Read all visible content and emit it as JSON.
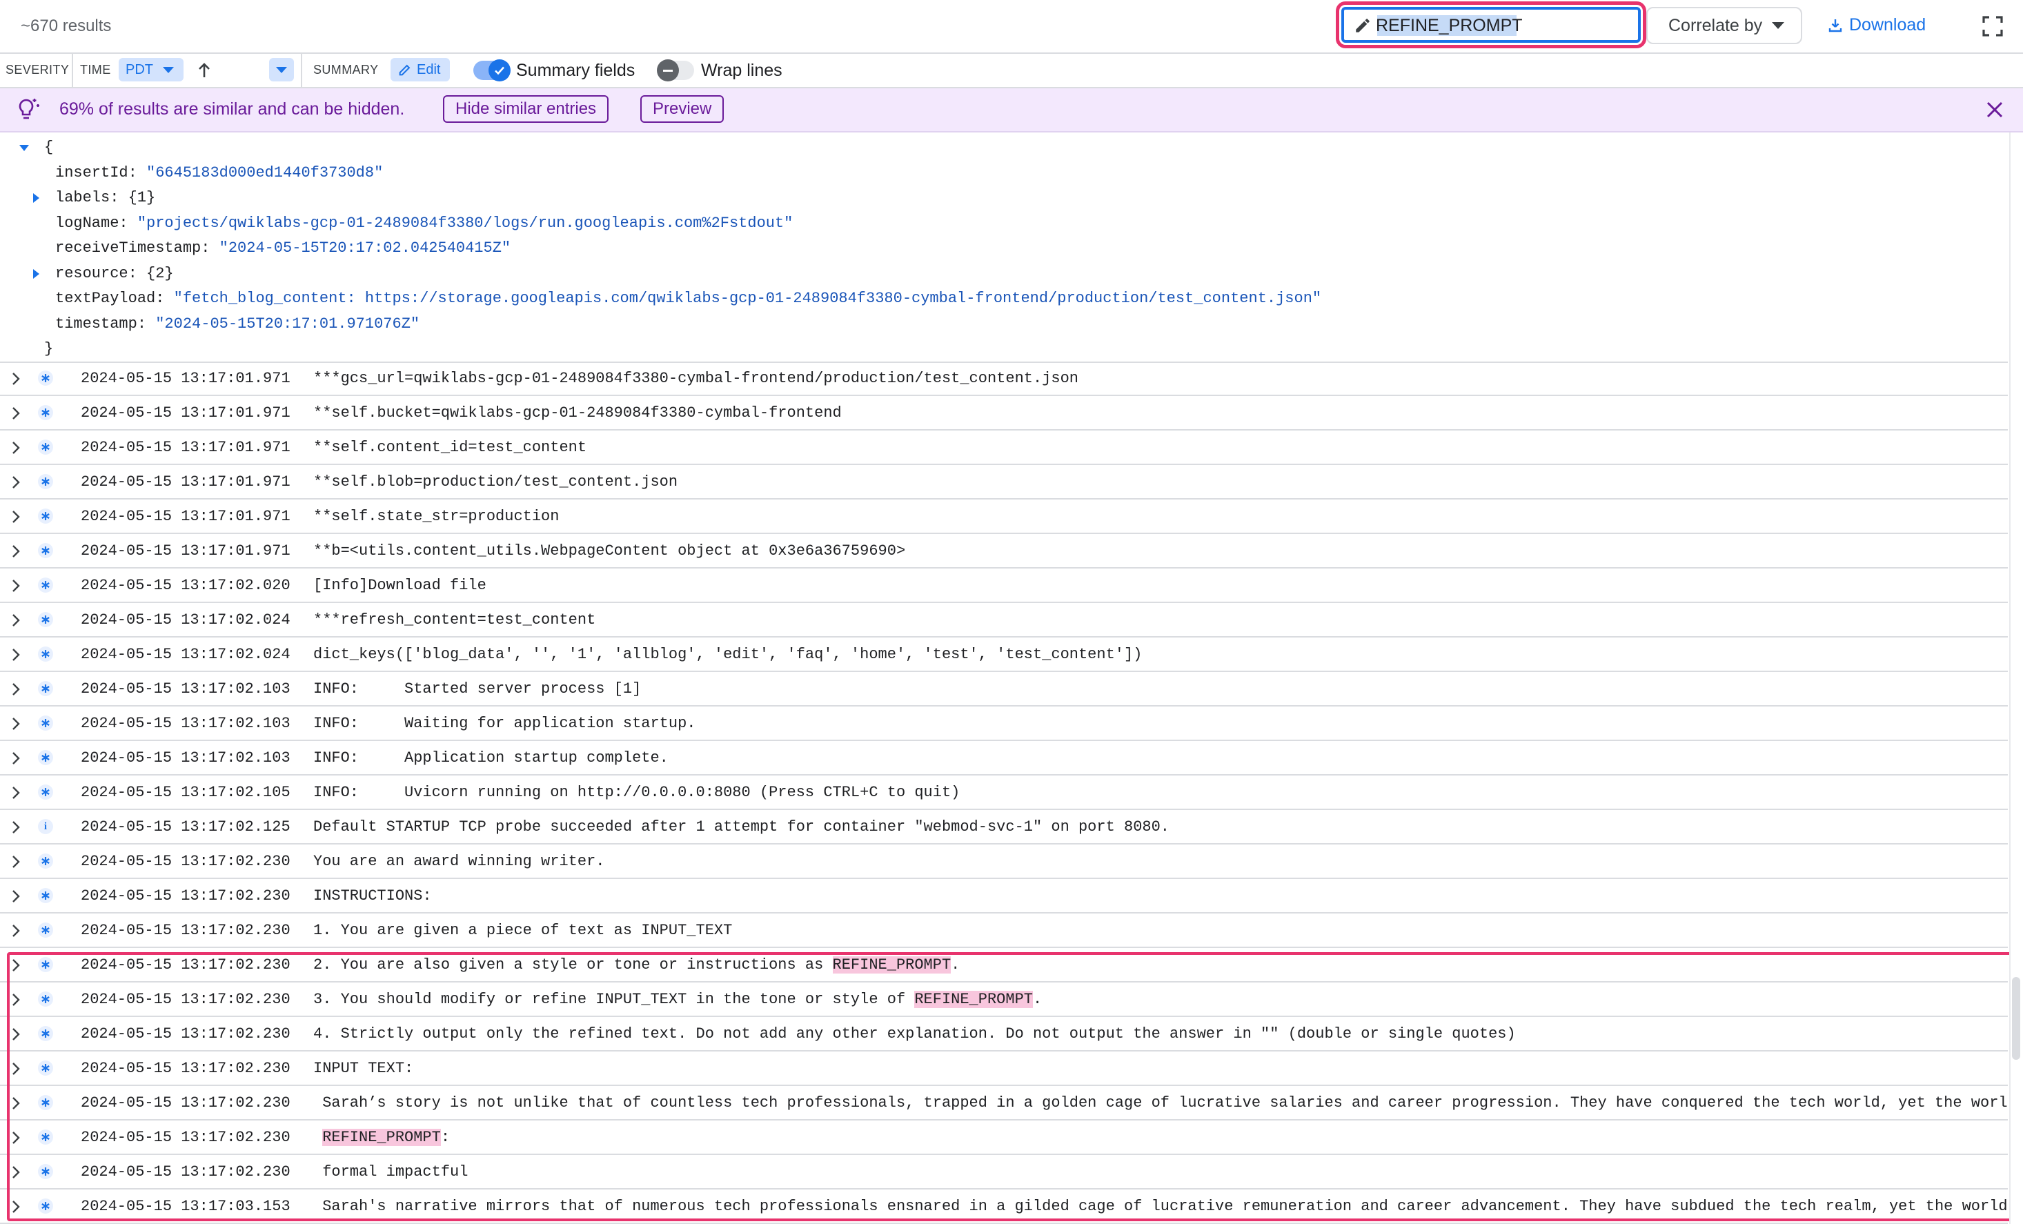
{
  "toolbar": {
    "results_count": "~670 results",
    "search_value": "REFINE_PROMPT",
    "correlate_label": "Correlate by",
    "download_label": "Download"
  },
  "columns": {
    "severity": "SEVERITY",
    "time": "TIME",
    "timezone": "PDT",
    "summary": "SUMMARY",
    "edit_label": "Edit",
    "summary_fields_label": "Summary fields",
    "summary_fields_on": true,
    "wrap_lines_label": "Wrap lines",
    "wrap_lines_on": false
  },
  "banner": {
    "message": "69% of results are similar and can be hidden.",
    "hide_label": "Hide similar entries",
    "preview_label": "Preview"
  },
  "expanded_entry": {
    "open_brace": "{",
    "close_brace": "}",
    "fields": [
      {
        "key": "insertId",
        "value": "\"6645183d000ed1440f3730d8\"",
        "expandable": false
      },
      {
        "key": "labels",
        "value": "{1}",
        "expandable": true
      },
      {
        "key": "logName",
        "value": "\"projects/qwiklabs-gcp-01-2489084f3380/logs/run.googleapis.com%2Fstdout\"",
        "expandable": false
      },
      {
        "key": "receiveTimestamp",
        "value": "\"2024-05-15T20:17:02.042540415Z\"",
        "expandable": false
      },
      {
        "key": "resource",
        "value": "{2}",
        "expandable": true
      },
      {
        "key": "textPayload",
        "value": "\"fetch_blog_content: https://storage.googleapis.com/qwiklabs-gcp-01-2489084f3380-cymbal-frontend/production/test_content.json\"",
        "expandable": false
      },
      {
        "key": "timestamp",
        "value": "\"2024-05-15T20:17:01.971076Z\"",
        "expandable": false
      }
    ]
  },
  "log_rows": [
    {
      "severity": "default",
      "ts": "2024-05-15 13:17:01.971",
      "msg": "***gcs_url=qwiklabs-gcp-01-2489084f3380-cymbal-frontend/production/test_content.json"
    },
    {
      "severity": "default",
      "ts": "2024-05-15 13:17:01.971",
      "msg": "**self.bucket=qwiklabs-gcp-01-2489084f3380-cymbal-frontend"
    },
    {
      "severity": "default",
      "ts": "2024-05-15 13:17:01.971",
      "msg": "**self.content_id=test_content"
    },
    {
      "severity": "default",
      "ts": "2024-05-15 13:17:01.971",
      "msg": "**self.blob=production/test_content.json"
    },
    {
      "severity": "default",
      "ts": "2024-05-15 13:17:01.971",
      "msg": "**self.state_str=production"
    },
    {
      "severity": "default",
      "ts": "2024-05-15 13:17:01.971",
      "msg": "**b=<utils.content_utils.WebpageContent object at 0x3e6a36759690>"
    },
    {
      "severity": "default",
      "ts": "2024-05-15 13:17:02.020",
      "msg": "[Info]Download file"
    },
    {
      "severity": "default",
      "ts": "2024-05-15 13:17:02.024",
      "msg": "***refresh_content=test_content"
    },
    {
      "severity": "default",
      "ts": "2024-05-15 13:17:02.024",
      "msg": "dict_keys(['blog_data', '', '1', 'allblog', 'edit', 'faq', 'home', 'test', 'test_content'])"
    },
    {
      "severity": "default",
      "ts": "2024-05-15 13:17:02.103",
      "msg": "INFO:     Started server process [1]"
    },
    {
      "severity": "default",
      "ts": "2024-05-15 13:17:02.103",
      "msg": "INFO:     Waiting for application startup."
    },
    {
      "severity": "default",
      "ts": "2024-05-15 13:17:02.103",
      "msg": "INFO:     Application startup complete."
    },
    {
      "severity": "default",
      "ts": "2024-05-15 13:17:02.105",
      "msg": "INFO:     Uvicorn running on http://0.0.0.0:8080 (Press CTRL+C to quit)"
    },
    {
      "severity": "info",
      "ts": "2024-05-15 13:17:02.125",
      "msg": "Default STARTUP TCP probe succeeded after 1 attempt for container \"webmod-svc-1\" on port 8080."
    },
    {
      "severity": "default",
      "ts": "2024-05-15 13:17:02.230",
      "msg": "You are an award winning writer."
    },
    {
      "severity": "default",
      "ts": "2024-05-15 13:17:02.230",
      "msg": "INSTRUCTIONS:"
    },
    {
      "severity": "default",
      "ts": "2024-05-15 13:17:02.230",
      "msg": "1. You are given a piece of text as INPUT_TEXT"
    },
    {
      "severity": "default",
      "ts": "2024-05-15 13:17:02.230",
      "msg": "2. You are also given a style or tone or instructions as ",
      "hl": "REFINE_PROMPT",
      "after": "."
    },
    {
      "severity": "default",
      "ts": "2024-05-15 13:17:02.230",
      "msg": "3. You should modify or refine INPUT_TEXT in the tone or style of ",
      "hl": "REFINE_PROMPT",
      "after": "."
    },
    {
      "severity": "default",
      "ts": "2024-05-15 13:17:02.230",
      "msg": "4. Strictly output only the refined text. Do not add any other explanation. Do not output the answer in \"\" (double or single quotes)"
    },
    {
      "severity": "default",
      "ts": "2024-05-15 13:17:02.230",
      "msg": "INPUT TEXT:"
    },
    {
      "severity": "default",
      "ts": "2024-05-15 13:17:02.230",
      "msg": " Sarah’s story is not unlike that of countless tech professionals, trapped in a golden cage of lucrative salaries and career progression. They have conquered the tech world, yet the worl"
    },
    {
      "severity": "default",
      "ts": "2024-05-15 13:17:02.230",
      "msg": " ",
      "hl": "REFINE_PROMPT",
      "after": ":"
    },
    {
      "severity": "default",
      "ts": "2024-05-15 13:17:02.230",
      "msg": " formal impactful"
    },
    {
      "severity": "default",
      "ts": "2024-05-15 13:17:03.153",
      "msg": " Sarah's narrative mirrors that of numerous tech professionals ensnared in a gilded cage of lucrative remuneration and career advancement. They have subdued the tech realm, yet the world"
    }
  ]
}
